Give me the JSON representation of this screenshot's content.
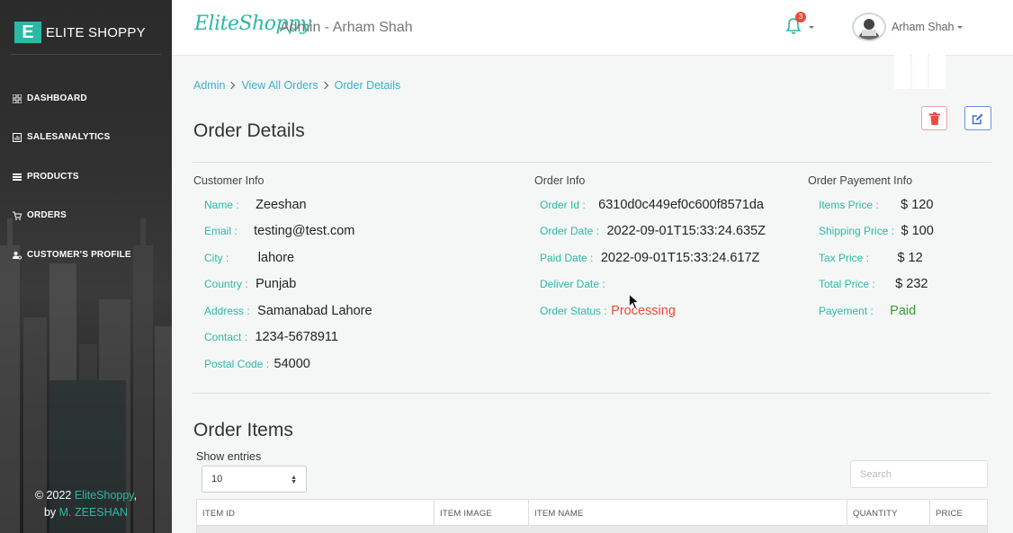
{
  "sidebar": {
    "brand_letter": "E",
    "brand_name": "ELITE SHOPPY",
    "items": [
      {
        "label": "DASHBOARD",
        "icon": "dashboard-icon"
      },
      {
        "label": "SALESANALYTICS",
        "icon": "chart-icon"
      },
      {
        "label": "PRODUCTS",
        "icon": "list-icon"
      },
      {
        "label": "ORDERS",
        "icon": "cart-icon"
      },
      {
        "label": "CUSTOMER'S PROFILE",
        "icon": "users-cog-icon"
      }
    ],
    "copyright_prefix": "© 2022 ",
    "copyright_brand": "EliteShoppy",
    "copyright_suffix": ",",
    "by_prefix": "by ",
    "author": "M. ZEESHAN"
  },
  "header": {
    "logo_text": "EliteShoppy",
    "admin_label": "Admin - Arham Shah",
    "notification_count": "3",
    "user_name": "Arham Shah"
  },
  "breadcrumb": [
    "Admin",
    "View All Orders",
    "Order Details"
  ],
  "page_title": "Order Details",
  "customer_info": {
    "title": "Customer Info",
    "fields": [
      {
        "label": "Name :",
        "value": "Zeeshan"
      },
      {
        "label": "Email :",
        "value": "testing@test.com"
      },
      {
        "label": "City :",
        "value": "lahore"
      },
      {
        "label": "Country :",
        "value": "Punjab"
      },
      {
        "label": "Address :",
        "value": "Samanabad Lahore"
      },
      {
        "label": "Contact :",
        "value": "1234-5678911"
      },
      {
        "label": "Postal Code :",
        "value": "54000"
      }
    ]
  },
  "order_info": {
    "title": "Order Info",
    "fields": [
      {
        "label": "Order Id :",
        "value": "6310d0c449ef0c600f8571da"
      },
      {
        "label": "Order Date :",
        "value": "2022-09-01T15:33:24.635Z"
      },
      {
        "label": "Paid Date :",
        "value": "2022-09-01T15:33:24.617Z"
      },
      {
        "label": "Deliver Date :",
        "value": ""
      },
      {
        "label": "Order Status :",
        "value": "Processing"
      }
    ]
  },
  "payment_info": {
    "title": "Order Payement Info",
    "fields": [
      {
        "label": "Items Price :",
        "value": "$ 120"
      },
      {
        "label": "Shipping Price :",
        "value": "$ 100"
      },
      {
        "label": "Tax Price :",
        "value": "$ 12"
      },
      {
        "label": "Total Price :",
        "value": "$ 232"
      },
      {
        "label": "Payement :",
        "value": "Paid"
      }
    ]
  },
  "order_items": {
    "title": "Order Items",
    "show_entries_label": "Show entries",
    "entries_value": "10",
    "search_placeholder": "Search",
    "columns": [
      "ITEM ID",
      "ITEM IMAGE",
      "ITEM NAME",
      "QUANTITY",
      "PRICE"
    ]
  },
  "colors": {
    "accent": "#2ab9a5",
    "link": "#3ab0c8",
    "status_processing": "#e74c3c",
    "status_paid": "#2f9e2f"
  }
}
